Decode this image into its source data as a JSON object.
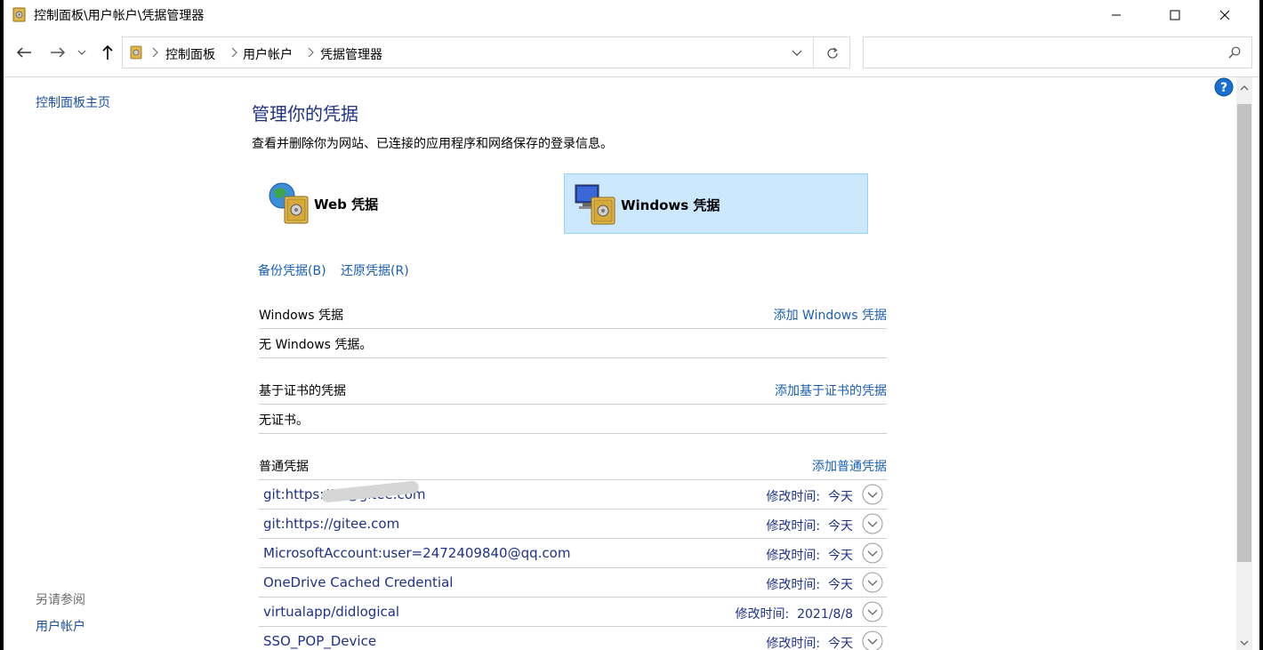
{
  "window": {
    "title": "控制面板\\用户帐户\\凭据管理器"
  },
  "nav": {
    "breadcrumbs": [
      "控制面板",
      "用户帐户",
      "凭据管理器"
    ],
    "search_placeholder": ""
  },
  "sidebar": {
    "home_link": "控制面板主页",
    "see_also_label": "另请参阅",
    "see_also_items": [
      "用户帐户"
    ]
  },
  "main": {
    "title": "管理你的凭据",
    "description": "查看并删除你为网站、已连接的应用程序和网络保存的登录信息。",
    "tiles": [
      {
        "label": "Web 凭据",
        "selected": false
      },
      {
        "label": "Windows 凭据",
        "selected": true
      }
    ],
    "backup_link": "备份凭据(B)",
    "restore_link": "还原凭据(R)",
    "sections": [
      {
        "title": "Windows 凭据",
        "action": "添加 Windows 凭据",
        "empty_text": "无 Windows 凭据。"
      },
      {
        "title": "基于证书的凭据",
        "action": "添加基于证书的凭据",
        "empty_text": "无证书。"
      },
      {
        "title": "普通凭据",
        "action": "添加普通凭据"
      }
    ],
    "generic_credentials": [
      {
        "name": "git:https://            7@gitee.com",
        "modified_label": "修改时间:",
        "modified": "今天"
      },
      {
        "name": "git:https://gitee.com",
        "modified_label": "修改时间:",
        "modified": "今天"
      },
      {
        "name": "MicrosoftAccount:user=2472409840@qq.com",
        "modified_label": "修改时间:",
        "modified": "今天"
      },
      {
        "name": "OneDrive Cached Credential",
        "modified_label": "修改时间:",
        "modified": "今天"
      },
      {
        "name": "virtualapp/didlogical",
        "modified_label": "修改时间:",
        "modified": "2021/8/8"
      },
      {
        "name": "SSO_POP_Device",
        "modified_label": "修改时间:",
        "modified": "今天"
      }
    ]
  },
  "colors": {
    "accent_link": "#1a5fb4",
    "title_blue": "#1e3287",
    "selected_tile_bg": "#cce8ff",
    "selected_tile_border": "#99d1ff"
  }
}
